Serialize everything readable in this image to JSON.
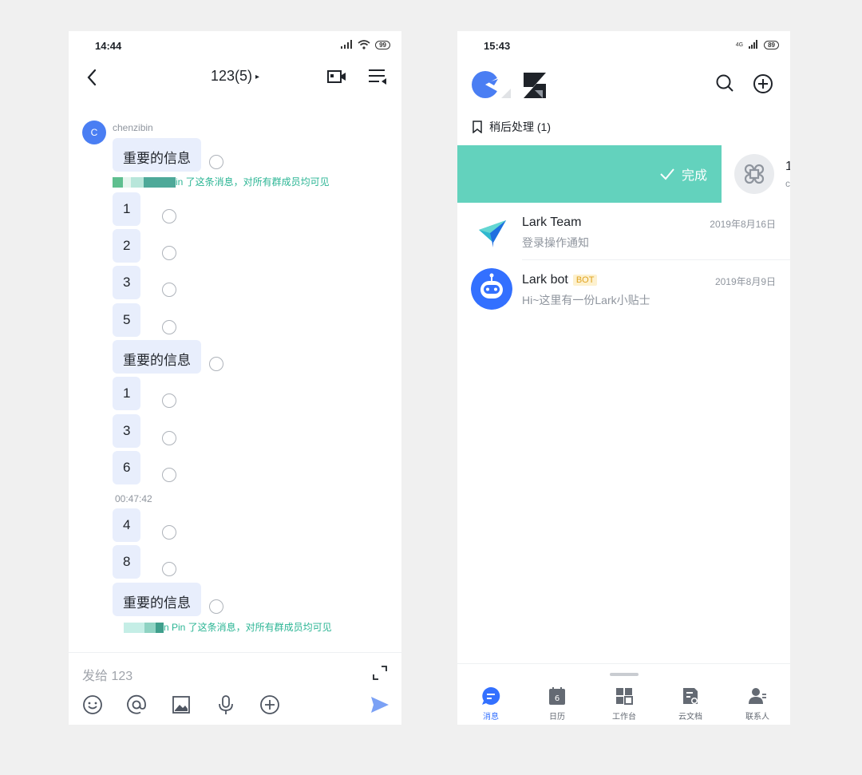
{
  "left": {
    "status": {
      "time": "14:44",
      "battery": "99"
    },
    "header": {
      "title": "123(5)",
      "caret": "▸"
    },
    "sender": {
      "initial": "C",
      "name": "chenzibin"
    },
    "messages": [
      {
        "text": "重要的信息"
      },
      {
        "text": "1"
      },
      {
        "text": "2"
      },
      {
        "text": "3"
      },
      {
        "text": "5"
      },
      {
        "text": "重要的信息"
      },
      {
        "text": "1"
      },
      {
        "text": "3"
      },
      {
        "text": "6"
      },
      {
        "text": "4"
      },
      {
        "text": "8"
      },
      {
        "text": "重要的信息"
      }
    ],
    "pin_notes": [
      "in 了这条消息，对所有群成员均可见",
      "n Pin 了这条消息，对所有群成员均可见"
    ],
    "time_separator": "00:47:42",
    "input": {
      "placeholder": "发给 123"
    }
  },
  "right": {
    "status": {
      "time": "15:43",
      "battery": "89",
      "network": "4G"
    },
    "later": "稍后处理 (1)",
    "swipe": {
      "done_label": "完成",
      "peek_title": "1",
      "peek_sub": "c"
    },
    "chats": [
      {
        "name": "Lark Team",
        "preview": "登录操作通知",
        "date": "2019年8月16日"
      },
      {
        "name": "Lark bot",
        "badge": "BOT",
        "preview": "Hi~这里有一份Lark小贴士",
        "date": "2019年8月9日"
      }
    ],
    "tabs": [
      {
        "label": "消息",
        "active": true
      },
      {
        "label": "日历",
        "day": "6"
      },
      {
        "label": "工作台"
      },
      {
        "label": "云文档"
      },
      {
        "label": "联系人"
      }
    ]
  },
  "colors": {
    "accent": "#3370ff",
    "done_green": "#63d2bd",
    "pin_green": "#2bb594",
    "bubble": "#e8eefc"
  },
  "icons": [
    "back-arrow-icon",
    "video-call-icon",
    "menu-icon",
    "emoji-icon",
    "at-icon",
    "image-icon",
    "mic-icon",
    "plus-circle-icon",
    "send-icon",
    "expand-icon",
    "search-icon",
    "add-icon",
    "bookmark-icon",
    "check-icon",
    "shortcut-icon",
    "paper-plane-icon",
    "robot-icon"
  ]
}
